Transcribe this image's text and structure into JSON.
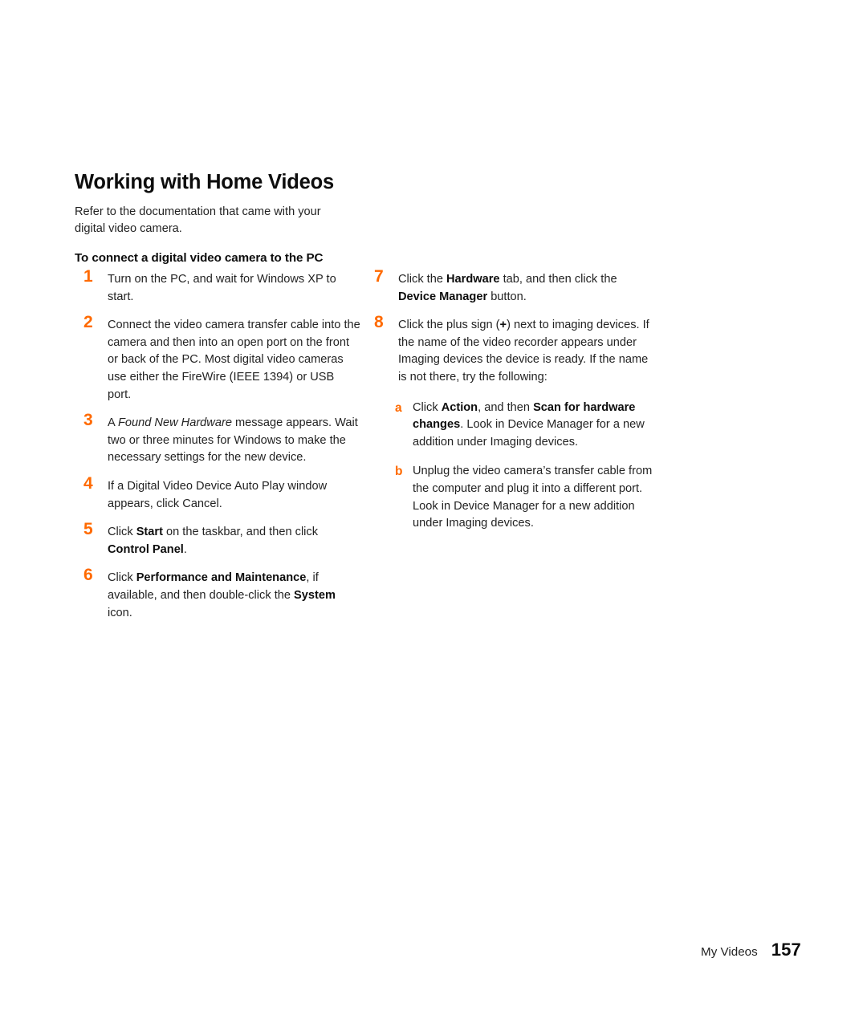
{
  "document": {
    "section_title": "Working with Home Videos",
    "intro": "Refer to the documentation that came with your digital video camera.",
    "subheading": "To connect a digital video camera to the PC",
    "accent_color": "#ff6a00",
    "text_color": "#232323"
  },
  "steps_left": [
    {
      "number": "1",
      "parts": [
        {
          "text": "Turn on the PC, and wait for Windows XP to start.",
          "style": "normal"
        }
      ]
    },
    {
      "number": "2",
      "parts": [
        {
          "text": "Connect the video camera transfer cable into the camera and then into an open port on the front or back of the PC. Most digital video cameras use either the FireWire (IEEE 1394) or USB port.",
          "style": "normal"
        }
      ]
    },
    {
      "number": "3",
      "parts": [
        {
          "text": "A ",
          "style": "normal"
        },
        {
          "text": "Found New Hardware",
          "style": "italic"
        },
        {
          "text": " message appears. Wait two or three minutes for Windows to make the necessary settings for the new device.",
          "style": "normal"
        }
      ]
    },
    {
      "number": "4",
      "parts": [
        {
          "text": "If a Digital Video Device Auto Play window appears, click Cancel.",
          "style": "normal"
        }
      ]
    },
    {
      "number": "5",
      "parts": [
        {
          "text": "Click ",
          "style": "normal"
        },
        {
          "text": "Start",
          "style": "bold"
        },
        {
          "text": " on the taskbar, and then click ",
          "style": "normal"
        },
        {
          "text": "Control Panel",
          "style": "bold"
        },
        {
          "text": ".",
          "style": "normal"
        }
      ]
    },
    {
      "number": "6",
      "parts": [
        {
          "text": "Click ",
          "style": "normal"
        },
        {
          "text": "Performance and Maintenance",
          "style": "bold"
        },
        {
          "text": ", if available, and then double-click the ",
          "style": "normal"
        },
        {
          "text": "System",
          "style": "bold"
        },
        {
          "text": " icon.",
          "style": "normal"
        }
      ]
    }
  ],
  "steps_right": [
    {
      "number": "7",
      "parts": [
        {
          "text": "Click the ",
          "style": "normal"
        },
        {
          "text": "Hardware",
          "style": "bold"
        },
        {
          "text": " tab, and then click the ",
          "style": "normal"
        },
        {
          "text": "Device Manager",
          "style": "bold"
        },
        {
          "text": " button.",
          "style": "normal"
        }
      ]
    },
    {
      "number": "8",
      "parts": [
        {
          "text": "Click the plus sign (",
          "style": "normal"
        },
        {
          "text": "+",
          "style": "bold"
        },
        {
          "text": ") next to imaging devices. If the name of the video recorder appears under Imaging devices the device is ready. If the name is not there, try the following:",
          "style": "normal"
        }
      ]
    }
  ],
  "substeps": [
    {
      "letter": "a",
      "parts": [
        {
          "text": "Click ",
          "style": "normal"
        },
        {
          "text": "Action",
          "style": "bold"
        },
        {
          "text": ", and then ",
          "style": "normal"
        },
        {
          "text": "Scan for hardware changes",
          "style": "bold"
        },
        {
          "text": ". Look in Device Manager for a new addition under Imaging devices.",
          "style": "normal"
        }
      ]
    },
    {
      "letter": "b",
      "parts": [
        {
          "text": "Unplug the video camera’s transfer cable from the computer and plug it into a different port. Look in Device Manager for a new addition under Imaging devices.",
          "style": "normal"
        }
      ]
    }
  ],
  "footer": {
    "label": "My Videos",
    "page_number": "157"
  }
}
